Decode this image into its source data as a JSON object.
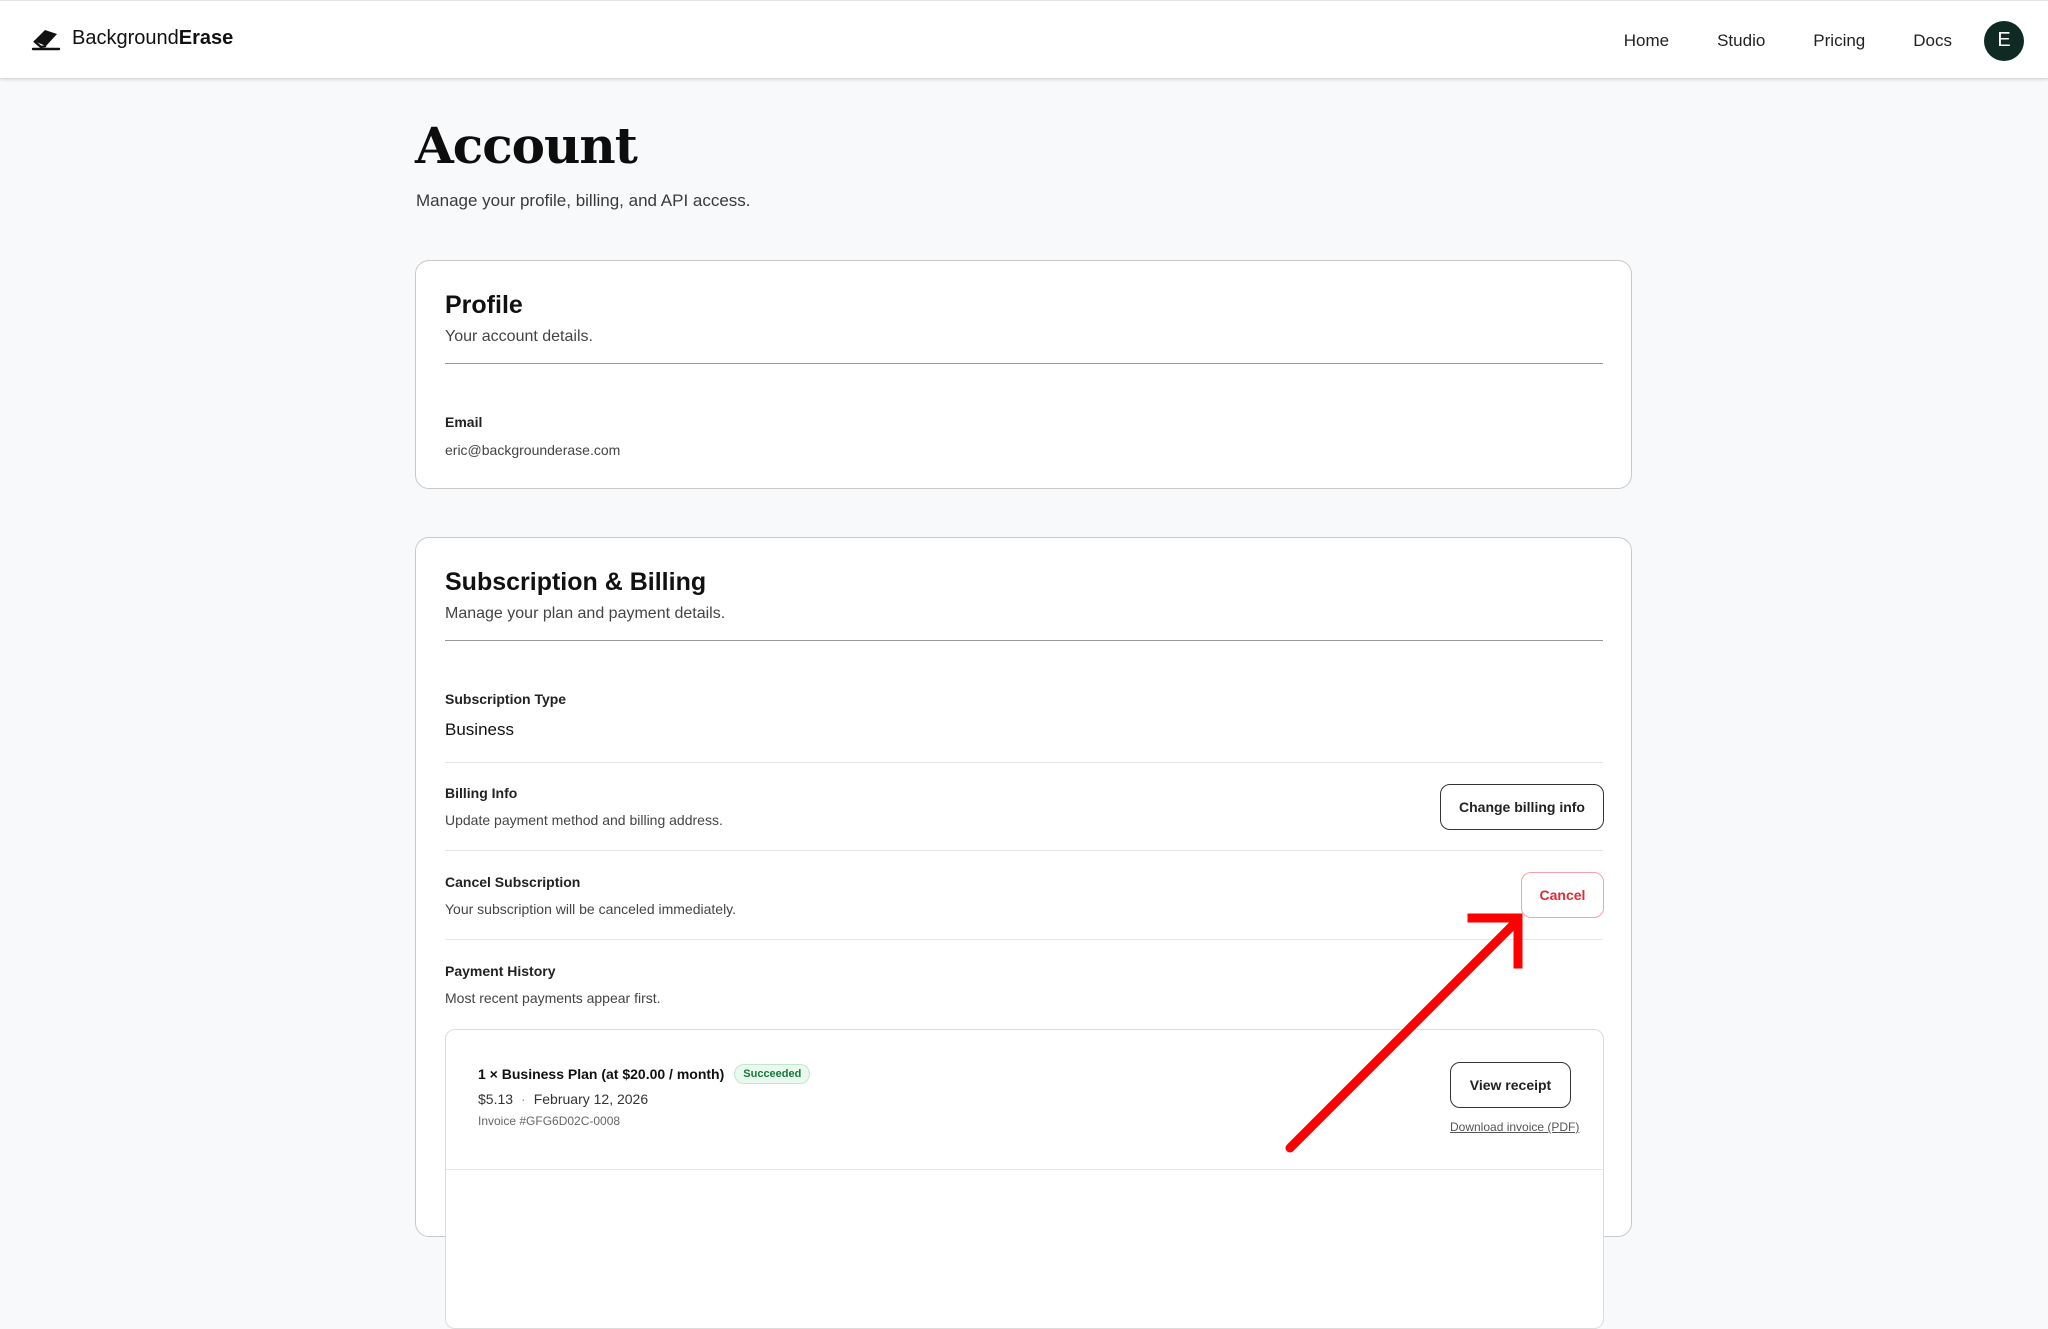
{
  "header": {
    "brand_regular": "Background",
    "brand_bold": "Erase",
    "nav": [
      "Home",
      "Studio",
      "Pricing",
      "Docs"
    ],
    "avatar_initial": "E"
  },
  "page": {
    "title": "Account",
    "subtitle": "Manage your profile, billing, and API access."
  },
  "profile": {
    "title": "Profile",
    "subtitle": "Your account details.",
    "email_label": "Email",
    "email_value": "eric@backgrounderase.com"
  },
  "billing": {
    "title": "Subscription & Billing",
    "subtitle": "Manage your plan and payment details.",
    "subscription_type_label": "Subscription Type",
    "subscription_type_value": "Business",
    "billing_info_label": "Billing Info",
    "billing_info_desc": "Update payment method and billing address.",
    "billing_info_button": "Change billing info",
    "cancel_label": "Cancel Subscription",
    "cancel_desc": "Your subscription will be canceled immediately.",
    "cancel_button": "Cancel",
    "history_label": "Payment History",
    "history_desc": "Most recent payments appear first.",
    "payments": [
      {
        "title": "1 × Business Plan (at $20.00 / month)",
        "status": "Succeeded",
        "amount": "$5.13",
        "date": "February 12, 2026",
        "invoice": "Invoice #GFG6D02C-0008",
        "receipt_button": "View receipt",
        "download_link": "Download invoice (PDF)"
      }
    ]
  },
  "colors": {
    "accent_dark": "#0f2a22",
    "danger": "#e02b36",
    "success": "#157a3a",
    "annotation_arrow": "#ff0000"
  }
}
